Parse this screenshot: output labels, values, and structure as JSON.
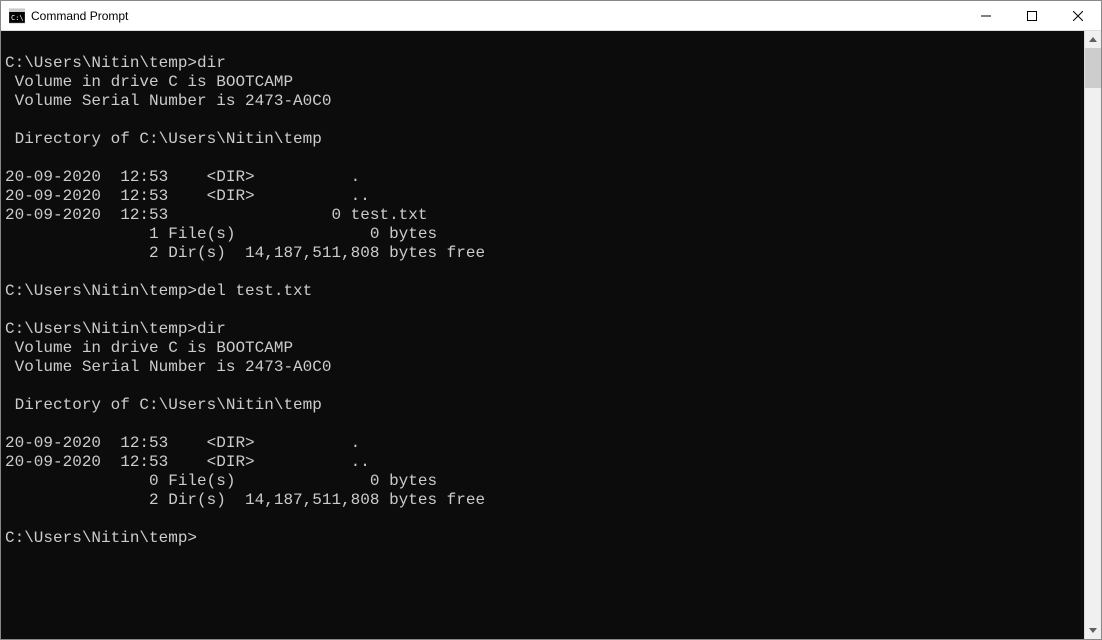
{
  "window": {
    "title": "Command Prompt"
  },
  "terminal": {
    "lines": [
      "",
      "C:\\Users\\Nitin\\temp>dir",
      " Volume in drive C is BOOTCAMP",
      " Volume Serial Number is 2473-A0C0",
      "",
      " Directory of C:\\Users\\Nitin\\temp",
      "",
      "20-09-2020  12:53    <DIR>          .",
      "20-09-2020  12:53    <DIR>          ..",
      "20-09-2020  12:53                 0 test.txt",
      "               1 File(s)              0 bytes",
      "               2 Dir(s)  14,187,511,808 bytes free",
      "",
      "C:\\Users\\Nitin\\temp>del test.txt",
      "",
      "C:\\Users\\Nitin\\temp>dir",
      " Volume in drive C is BOOTCAMP",
      " Volume Serial Number is 2473-A0C0",
      "",
      " Directory of C:\\Users\\Nitin\\temp",
      "",
      "20-09-2020  12:53    <DIR>          .",
      "20-09-2020  12:53    <DIR>          ..",
      "               0 File(s)              0 bytes",
      "               2 Dir(s)  14,187,511,808 bytes free",
      "",
      "C:\\Users\\Nitin\\temp>"
    ]
  }
}
